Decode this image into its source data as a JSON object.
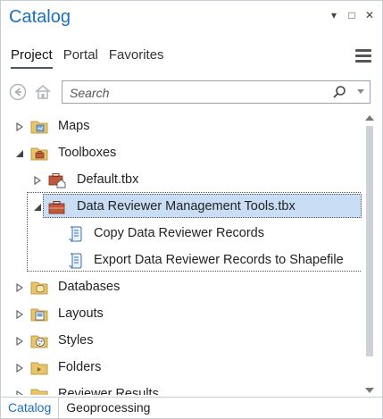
{
  "window": {
    "title": "Catalog",
    "buttons": {
      "menu": "▾",
      "maximize": "□",
      "close": "✕"
    }
  },
  "tabs": [
    "Project",
    "Portal",
    "Favorites"
  ],
  "search": {
    "placeholder": "Search"
  },
  "tree": {
    "maps": "Maps",
    "toolboxes": "Toolboxes",
    "default_tbx": "Default.tbx",
    "dr_tbx": "Data Reviewer Management Tools.tbx",
    "copy_records": "Copy Data Reviewer Records",
    "export_records": "Export Data Reviewer Records to Shapefile",
    "databases": "Databases",
    "layouts": "Layouts",
    "styles": "Styles",
    "folders": "Folders",
    "reviewer_results": "Reviewer Results"
  },
  "bottom_tabs": [
    "Catalog",
    "Geoprocessing"
  ],
  "colors": {
    "accent": "#1a6fbf",
    "folder": "#e8c46a",
    "toolbox": "#c0583a",
    "selection": "#c9def5"
  }
}
